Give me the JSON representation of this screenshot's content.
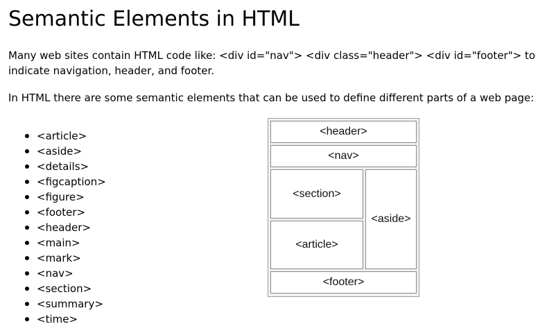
{
  "title": "Semantic Elements in HTML",
  "intro_paragraph": "Many web sites contain HTML code like: <div id=\"nav\"> <div class=\"header\"> <div id=\"footer\"> to indicate navigation, header, and footer.",
  "semantic_paragraph": "In HTML there are some semantic elements that can be used to define different parts of a web page:",
  "elements": [
    "<article>",
    "<aside>",
    "<details>",
    "<figcaption>",
    "<figure>",
    "<footer>",
    "<header>",
    "<main>",
    "<mark>",
    "<nav>",
    "<section>",
    "<summary>",
    "<time>"
  ],
  "diagram": {
    "header": "<header>",
    "nav": "<nav>",
    "section": "<section>",
    "article": "<article>",
    "aside": "<aside>",
    "footer": "<footer>"
  }
}
